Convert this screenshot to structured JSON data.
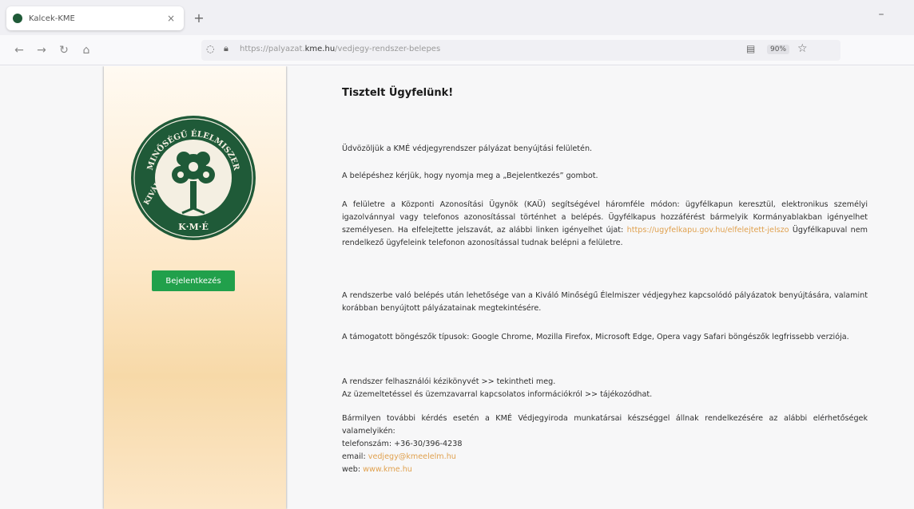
{
  "browser": {
    "tab_title": "Kalcek-KME",
    "tab_close": "×",
    "new_tab": "+",
    "minimize": "–",
    "nav": {
      "back": "←",
      "forward": "→",
      "reload": "↻",
      "home": "⌂"
    },
    "url_prefix": "https://palyazat.",
    "url_domain": "kme.hu",
    "url_suffix": "/vedjegy-rendszer-belepes",
    "zoom": "90%"
  },
  "sidebar": {
    "logo_text_top": "MINŐSÉGŰ ÉLELMISZER",
    "logo_text_left": "KIVÁLÓ",
    "logo_text_bottom": "K·M·É",
    "login_button": "Bejelentkezés"
  },
  "content": {
    "heading": "Tisztelt Ügyfelünk!",
    "p1": "Üdvözöljük a KMÉ védjegyrendszer pályázat benyújtási felületén.",
    "p2": "A belépéshez kérjük, hogy nyomja meg a „Bejelentkezés” gombot.",
    "p3_a": "A felületre a Központi Azonosítási Ügynök (KAÜ) segítségével háromféle módon: ügyfélkapun keresztül, elektronikus személyi igazolvánnyal vagy telefonos azonosítással történhet a belépés. Ügyfélkapus hozzáférést bármelyik Kormányablakban igényelhet személyesen. Ha elfelejtette jelszavát, az alábbi linken igényelhet újat:",
    "p3_link": "https://ugyfelkapu.gov.hu/elfelejtett-jelszo",
    "p3_b": "Ügyfélkapuval nem rendelkező ügyfeleink telefonon azonosítással tudnak belépni a felületre.",
    "p4": "A rendszerbe való belépés után lehetősége van a Kiváló Minőségű Élelmiszer védjegyhez kapcsolódó pályázatok benyújtására, valamint korábban benyújtott pályázatainak megtekintésére.",
    "p5": "A támogatott böngészők típusok: Google Chrome, Mozilla Firefox, Microsoft Edge, Opera vagy Safari böngészők legfrissebb verziója.",
    "p6_line1": "A rendszer felhasználói kézikönyvét >> tekintheti meg.",
    "p6_line2": "Az üzemeltetéssel és üzemzavarral kapcsolatos információkról >> tájékozódhat.",
    "p7_line1": "Bármilyen további kérdés esetén a KMÉ Védjegyiroda munkatársai készséggel állnak rendelkezésére az alábbi elérhetőségek valamelyikén:",
    "p7_phone": "telefonszám: +36-30/396-4238",
    "p7_email_label": "email:",
    "p7_email": "vedjegy@kmeelelm.hu",
    "p7_web_label": "web:",
    "p7_web": "www.kme.hu"
  },
  "colors": {
    "brand_green": "#1f5a38",
    "button_green": "#21a04b",
    "link_orange": "#e0a14f"
  }
}
